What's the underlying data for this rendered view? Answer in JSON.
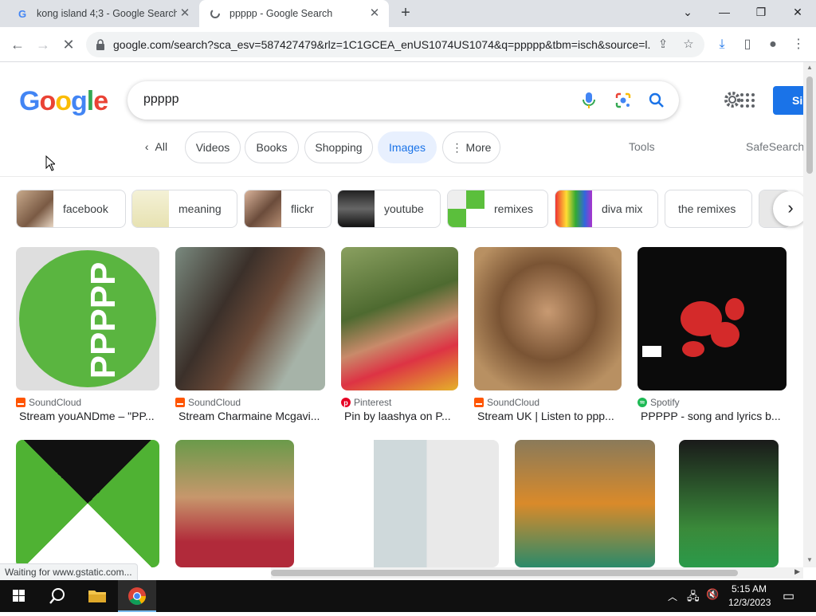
{
  "tabs": [
    {
      "title": "kong island 4;3 - Google Search",
      "active": false
    },
    {
      "title": "ppppp - Google Search",
      "active": true
    }
  ],
  "address_bar": {
    "url": "google.com/search?sca_esv=587427479&rlz=1C1GCEA_enUS1074US1074&q=ppppp&tbm=isch&source=l..."
  },
  "search": {
    "query": "ppppp",
    "signin_label": "Si"
  },
  "filters": {
    "all": "All",
    "chips": [
      "Videos",
      "Books",
      "Shopping",
      "Images",
      "More"
    ],
    "selected": "Images",
    "tools": "Tools",
    "safesearch": "SafeSearch"
  },
  "related": [
    "facebook",
    "meaning",
    "flickr",
    "youtube",
    "remixes",
    "diva mix",
    "the remixes"
  ],
  "results": [
    {
      "source": "SoundCloud",
      "title": "Stream youANDme – \"PP...",
      "source_color": "#ff5500",
      "image_text": "PPPPP"
    },
    {
      "source": "SoundCloud",
      "title": "Stream Charmaine Mcgavi...",
      "source_color": "#ff5500"
    },
    {
      "source": "Pinterest",
      "title": "Pin by laashya on P...",
      "source_color": "#e60023"
    },
    {
      "source": "SoundCloud",
      "title": "Stream UK | Listen to ppp...",
      "source_color": "#ff5500"
    },
    {
      "source": "Spotify",
      "title": "PPPPP - song and lyrics b...",
      "source_color": "#1db954"
    }
  ],
  "status_bar": {
    "text": "Waiting for www.gstatic.com..."
  },
  "taskbar": {
    "time": "5:15 AM",
    "date": "12/3/2023"
  },
  "colors": {
    "google_blue": "#1a73e8",
    "chip_selected_bg": "#e8f0fe",
    "taskbar": "#101010"
  }
}
